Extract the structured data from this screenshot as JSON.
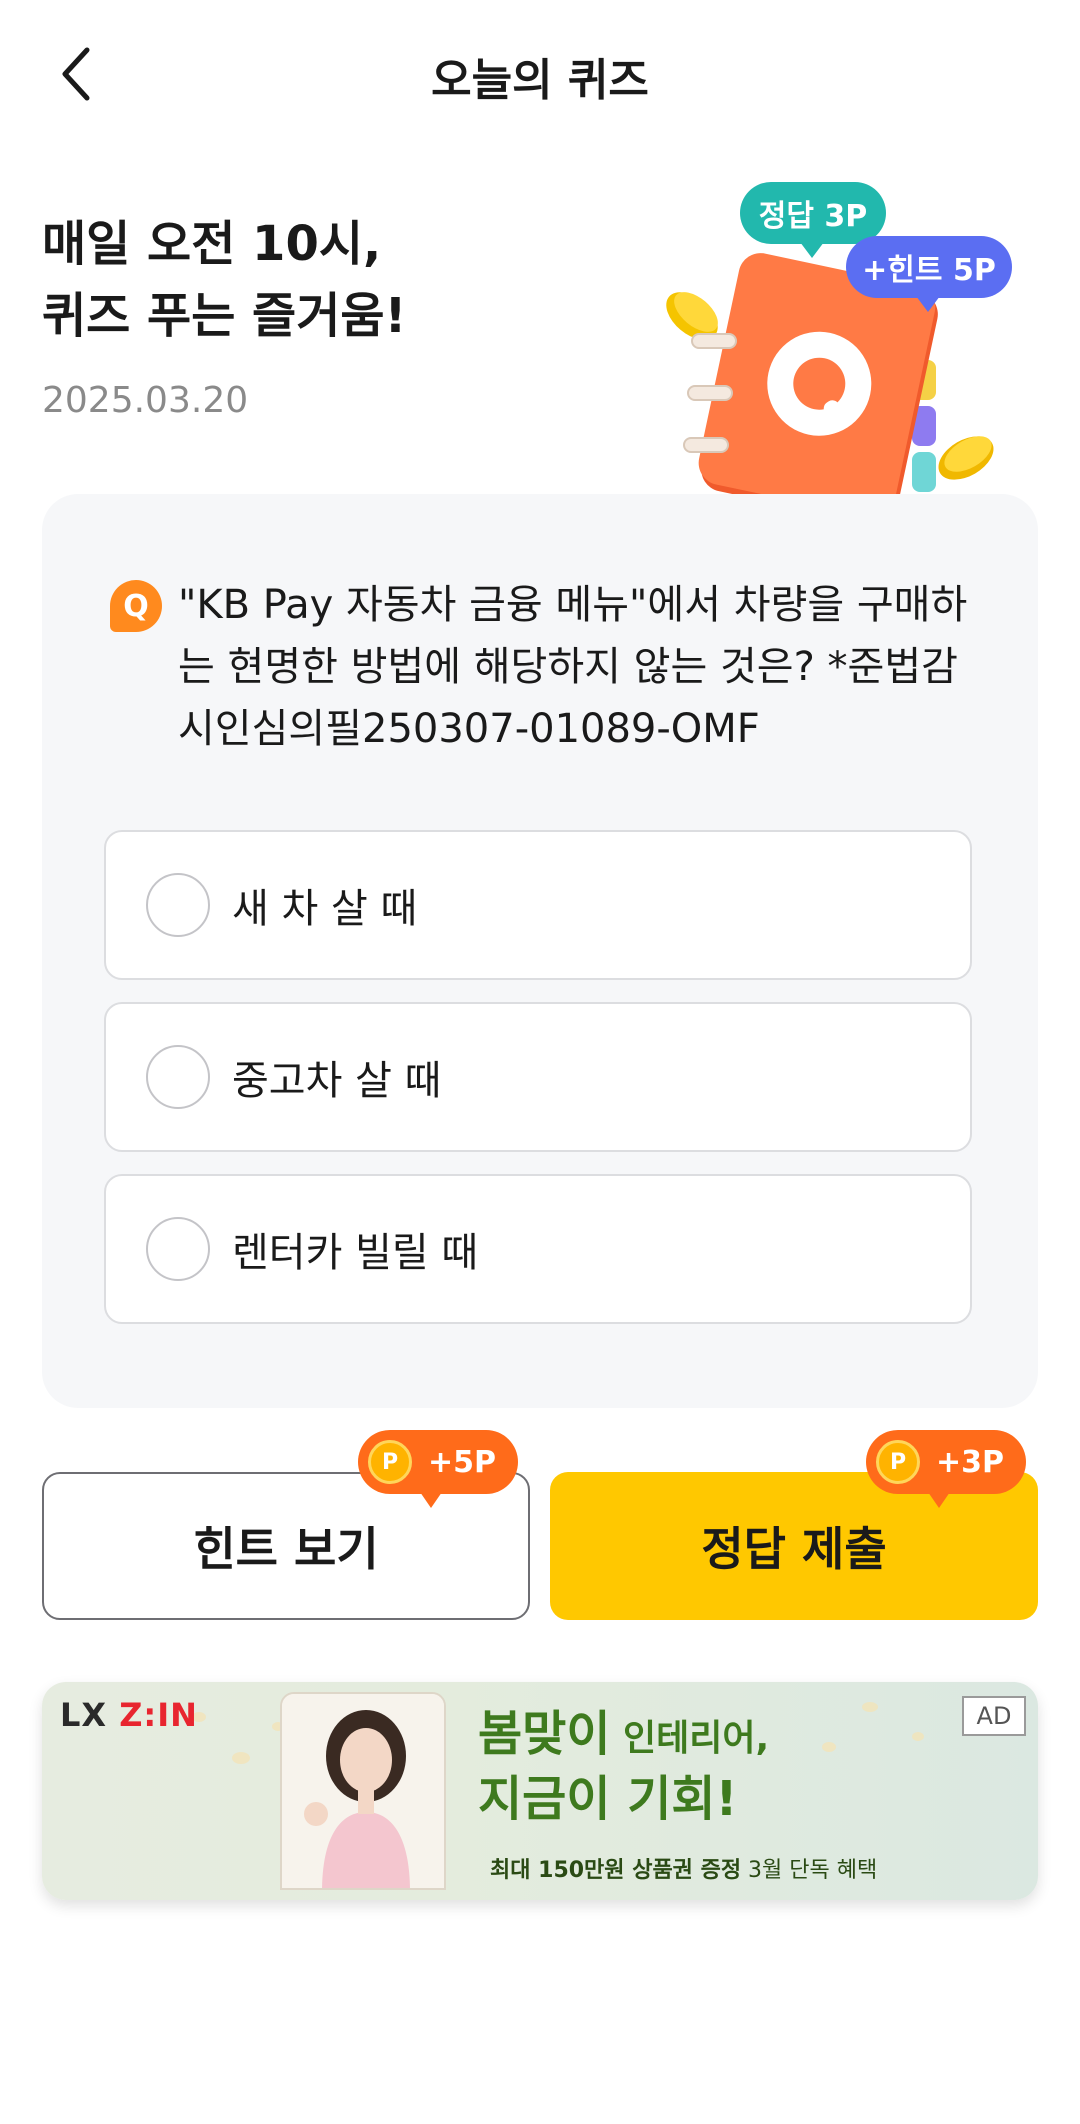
{
  "header": {
    "title": "오늘의 퀴즈",
    "back_icon": "chevron-left-icon"
  },
  "hero": {
    "title_line1": "매일 오전 10시,",
    "title_line2": "퀴즈 푸는 즐거움!",
    "date": "2025.03.20",
    "badge_answer": "정답 3P",
    "badge_hint": "+힌트 5P",
    "illustration_letter": "Q"
  },
  "question": {
    "badge": "Q",
    "line1": "\"KB Pay 자동차 금융 메뉴\"에서 차량을 구매하",
    "line2": "는 현명한 방법에 해당하지 않는 것은? *준법감",
    "line3": "시인심의필250307-01089-OMF"
  },
  "options": [
    {
      "label": "새 차 살 때"
    },
    {
      "label": "중고차 살 때"
    },
    {
      "label": "렌터카 빌릴 때"
    }
  ],
  "buttons": {
    "hint_label": "힌트 보기",
    "hint_reward": "+5P",
    "submit_label": "정답 제출",
    "submit_reward": "+3P",
    "coin_symbol": "P"
  },
  "ad": {
    "brand_lx": "LX",
    "brand_zin": "Z:IN",
    "tag": "AD",
    "headline_big": "봄맞이",
    "headline_small": " 인테리어,",
    "headline_line2": "지금이 기회!",
    "sub_bold": "최대 150만원 상품권 증정",
    "sub_rest": " 3월 단독 혜택"
  },
  "colors": {
    "accent_yellow": "#ffc800",
    "reward_orange": "#ff6b1a",
    "badge_teal": "#22b8ad",
    "badge_purple": "#5b6ef2",
    "q_orange": "#ff8a1e"
  }
}
